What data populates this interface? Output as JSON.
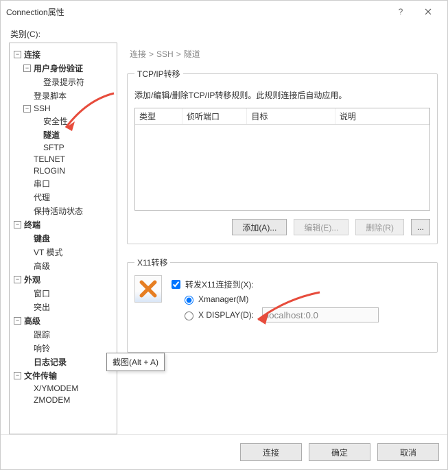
{
  "window": {
    "title": "Connection属性"
  },
  "category_label": "类别(C):",
  "tree": {
    "connection": "连接",
    "auth": "用户身份验证",
    "login_prompt": "登录提示符",
    "login_script": "登录脚本",
    "ssh": "SSH",
    "security": "安全性",
    "tunnel": "隧道",
    "sftp": "SFTP",
    "telnet": "TELNET",
    "rlogin": "RLOGIN",
    "serial": "串口",
    "proxy": "代理",
    "keepalive": "保持活动状态",
    "terminal": "终端",
    "keyboard": "键盘",
    "vt": "VT 模式",
    "advanced_term": "高级",
    "appearance": "外观",
    "window_item": "窗口",
    "highlight": "突出",
    "advanced": "高级",
    "trace": "跟踪",
    "bell": "响铃",
    "log": "日志记录",
    "filetrans": "文件传输",
    "xymodem": "X/YMODEM",
    "zmodem": "ZMODEM"
  },
  "breadcrumb": {
    "a": "连接",
    "b": "SSH",
    "c": "隧道"
  },
  "tcpip": {
    "legend": "TCP/IP转移",
    "desc": "添加/编辑/删除TCP/IP转移规则。此规则连接后自动应用。",
    "cols": {
      "type": "类型",
      "port": "侦听端口",
      "target": "目标",
      "desc": "说明"
    },
    "buttons": {
      "add": "添加(A)...",
      "edit": "编辑(E)...",
      "delete": "删除(R)",
      "ellipsis": "..."
    }
  },
  "x11": {
    "legend": "X11转移",
    "forward": "转发X11连接到(X):",
    "xmanager": "Xmanager(M)",
    "xdisplay_label": "X DISPLAY(D):",
    "xdisplay_value": "localhost:0.0"
  },
  "dialog": {
    "connect": "连接",
    "ok": "确定",
    "cancel": "取消"
  },
  "tooltip": "截图(Alt + A)"
}
